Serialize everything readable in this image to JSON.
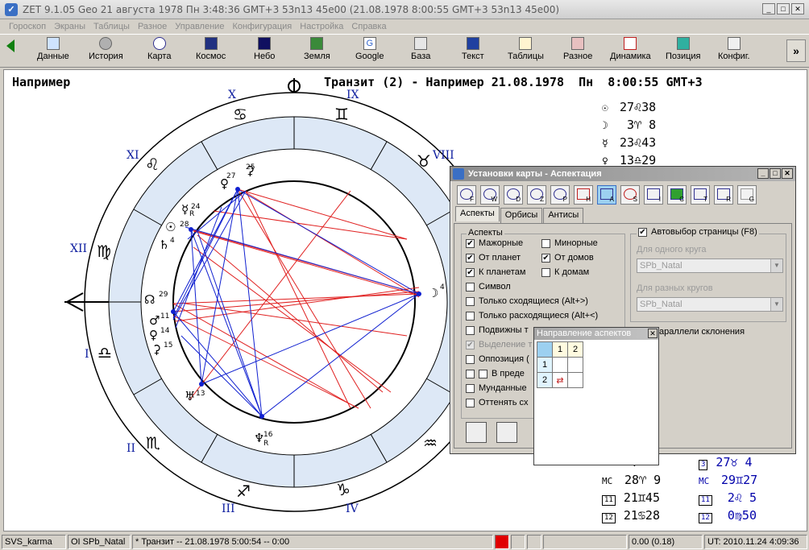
{
  "window": {
    "title": "ZET 9.1.05 Geo   21 августа 1978  Пн   3:48:36 GMT+3 53n13  45e00   (21.08.1978   8:00:55 GMT+3 53n13  45e00)"
  },
  "menu": [
    "Гороскоп",
    "Экраны",
    "Таблицы",
    "Разное",
    "Управление",
    "Конфигурация",
    "Настройка",
    "Справка"
  ],
  "toolbar": [
    {
      "label": "Данные",
      "icon": "data-icon"
    },
    {
      "label": "История",
      "icon": "history-icon"
    },
    {
      "label": "Карта",
      "icon": "chart-icon"
    },
    {
      "label": "Космос",
      "icon": "cosmos-icon"
    },
    {
      "label": "Небо",
      "icon": "sky-icon"
    },
    {
      "label": "Земля",
      "icon": "earth-icon"
    },
    {
      "label": "Google",
      "icon": "google-icon"
    },
    {
      "label": "База",
      "icon": "database-icon"
    },
    {
      "label": "Текст",
      "icon": "text-icon"
    },
    {
      "label": "Таблицы",
      "icon": "tables-icon"
    },
    {
      "label": "Разное",
      "icon": "misc-icon"
    },
    {
      "label": "Динамика",
      "icon": "dynamics-icon"
    },
    {
      "label": "Позиция",
      "icon": "position-icon"
    },
    {
      "label": "Конфиг.",
      "icon": "config-icon"
    }
  ],
  "chart_header": {
    "left": "Например",
    "right": "Транзит (2) - Например 21.08.1978  Пн  8:00:55 GMT+3"
  },
  "houses": [
    "I",
    "II",
    "III",
    "IV",
    "VIII",
    "IX",
    "X",
    "XI",
    "XII"
  ],
  "planets": [
    {
      "glyph": "☉",
      "pos": "27♌38"
    },
    {
      "glyph": "☽",
      "pos": " 3♈ 8"
    },
    {
      "glyph": "☿",
      "pos": "23♌43"
    },
    {
      "glyph": "♀",
      "pos": "13♎29"
    }
  ],
  "wheel_labels": {
    "moon_deg": "4",
    "sat_deg": "4",
    "sun_deg": "28",
    "merc_deg": "24",
    "venus_deg": "27",
    "pluto_deg": "25",
    "asc_deg": "29",
    "mars_deg": "11",
    "venus2_deg": "14",
    "ceres_deg": "15",
    "uranus_deg": "13",
    "neptune_deg": "16",
    "retro": "R"
  },
  "cusps_left": [
    {
      "label": "",
      "pos": " 7"
    },
    {
      "label": "MC",
      "pos": "28♈ 9"
    },
    {
      "label": "11",
      "pos": "21♊45"
    },
    {
      "label": "12",
      "pos": "21♋28"
    }
  ],
  "cusps_right": [
    {
      "label": "3",
      "pos": "27♉ 4"
    },
    {
      "label": "MC",
      "pos": "29♊27"
    },
    {
      "label": "11",
      "pos": " 2♌ 5"
    },
    {
      "label": "12",
      "pos": " 0♍50"
    }
  ],
  "dialog": {
    "title": "Установки карты - Аспектация",
    "icons": [
      "F",
      "W",
      "D",
      "Z",
      "P",
      "H",
      "A",
      "S",
      "I",
      "C",
      "T",
      "R",
      "G"
    ],
    "tabs": [
      "Аспекты",
      "Орбисы",
      "Антисы"
    ],
    "aspects_group": "Аспекты",
    "checks": [
      {
        "label": "Мажорные",
        "checked": true
      },
      {
        "label": "Минорные",
        "checked": false
      },
      {
        "label": "От планет",
        "checked": true
      },
      {
        "label": "От домов",
        "checked": true
      },
      {
        "label": "К планетам",
        "checked": true
      },
      {
        "label": "К домам",
        "checked": false
      },
      {
        "label": "Символ",
        "checked": false
      },
      {
        "label": "Только сходящиеся (Alt+>)",
        "checked": false
      },
      {
        "label": "Только расходящиеся (Alt+<)",
        "checked": false
      },
      {
        "label": "Подвижны т",
        "checked": false
      },
      {
        "label": "Выделение т",
        "checked": true
      },
      {
        "label": "Оппозиция (",
        "checked": false
      },
      {
        "label": "В преде",
        "checked": false
      },
      {
        "label": "Мунданные",
        "checked": false
      },
      {
        "label": "Оттенять сх",
        "checked": false
      }
    ],
    "auto_select": "Автовыбор страницы (F8)",
    "one_circle_label": "Для одного круга",
    "one_circle_value": "SPb_Natal",
    "diff_circles_label": "Для разных кругов",
    "diff_circles_value": "SPb_Natal",
    "parallels": "араллели склонения"
  },
  "popup": {
    "title": "Направление аспектов",
    "cols": [
      "1",
      "2"
    ],
    "rows": [
      "1",
      "2"
    ]
  },
  "status": {
    "profile": "SVS_karma",
    "natal": "OI SPb_Natal",
    "transit": "*  Транзит -- 21.08.1978  5:00:54 -- 0:00",
    "value": "0.00 (0.18)",
    "ut": "UT: 2010.11.24   4:09:36"
  }
}
